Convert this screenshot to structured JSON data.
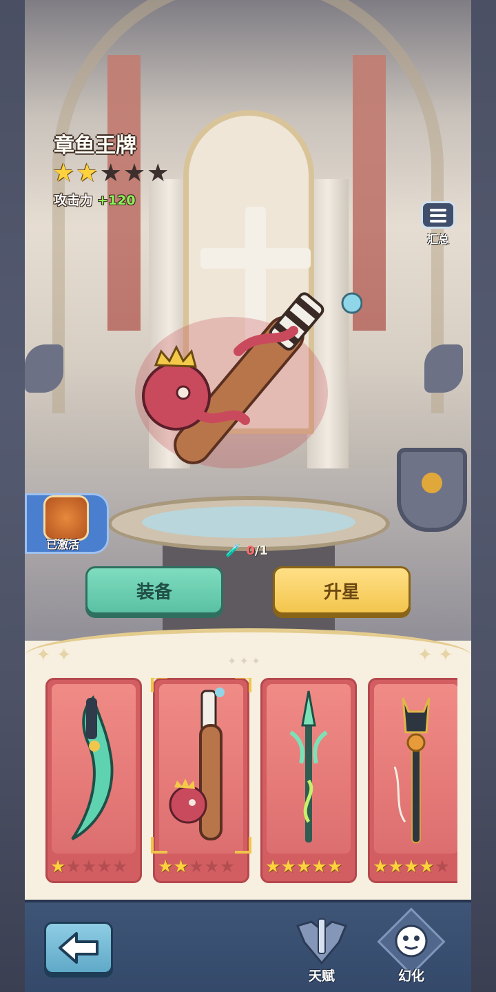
{
  "item": {
    "name": "章鱼王牌",
    "stars_filled": 2,
    "stars_total": 5,
    "attack_label": "攻击力",
    "attack_value": "+120"
  },
  "summary_button": {
    "label": "汇总",
    "icon": "list-icon"
  },
  "activation": {
    "label": "已激活",
    "icon": "flame-figure-icon"
  },
  "material_counter": {
    "icon": "bottle-icon",
    "current": "0",
    "separator_total": "/1"
  },
  "actions": {
    "equip_label": "装备",
    "upgrade_label": "升星"
  },
  "weapon_cards": [
    {
      "weapon": "jade-scimitar",
      "stars_filled": 1,
      "stars_total": 5,
      "selected": false
    },
    {
      "weapon": "octopus-club",
      "stars_filled": 2,
      "stars_total": 5,
      "selected": true
    },
    {
      "weapon": "jade-trident",
      "stars_filled": 5,
      "stars_total": 5,
      "selected": false
    },
    {
      "weapon": "anubis-staff",
      "stars_filled": 4,
      "stars_total": 5,
      "selected": false
    }
  ],
  "footer": {
    "back_icon": "arrow-left-icon",
    "tabs": [
      {
        "label": "天赋",
        "icon": "shield-sword-icon",
        "active": false
      },
      {
        "label": "幻化",
        "icon": "mask-icon",
        "active": true
      }
    ]
  },
  "colors": {
    "star_on": "#ffd23e",
    "star_off": "#3c2f2d",
    "attack_bonus": "#8ef058",
    "equip_button": "#6fd1b3",
    "upgrade_button": "#f7cf5d",
    "card_bg": "#d25e62",
    "footer_bg": "#3a5072"
  }
}
